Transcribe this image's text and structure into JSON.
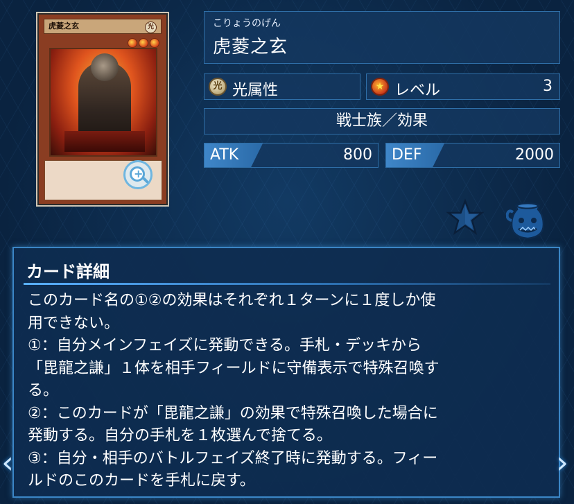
{
  "card": {
    "image_name": "虎菱之玄",
    "image_attribute": "光",
    "ruby": "こりょうのげん",
    "name": "虎菱之玄",
    "attribute_label": "光属性",
    "attribute_icon": "光",
    "level_label": "レベル",
    "level_value": "3",
    "type_line": "戦士族／効果",
    "atk_label": "ATK",
    "atk_value": "800",
    "def_label": "DEF",
    "def_value": "2000"
  },
  "detail": {
    "title": "カード詳細",
    "lines": [
      "このカード名の①②の効果はそれぞれ１ターンに１度しか使",
      "用できない。",
      "①：自分メインフェイズに発動できる。手札・デッキから",
      "「毘龍之謙」１体を相手フィールドに守備表示で特殊召喚す",
      "る。",
      "②：このカードが「毘龍之謙」の効果で特殊召喚した場合に",
      "発動する。自分の手札を１枚選んで捨てる。",
      "③：自分・相手のバトルフェイズ終了時に発動する。フィー",
      "ルドのこのカードを手札に戻す。"
    ]
  },
  "icons": {
    "zoom": "zoom-in-icon",
    "favorite": "star-icon",
    "pot": "pot-of-greed-icon",
    "prev": "chevron-left-icon",
    "next": "chevron-right-icon"
  },
  "colors": {
    "background": "#0a2340",
    "panel": "#14375f",
    "panel_border": "#2f6fa8",
    "accent": "#3f86c8"
  }
}
